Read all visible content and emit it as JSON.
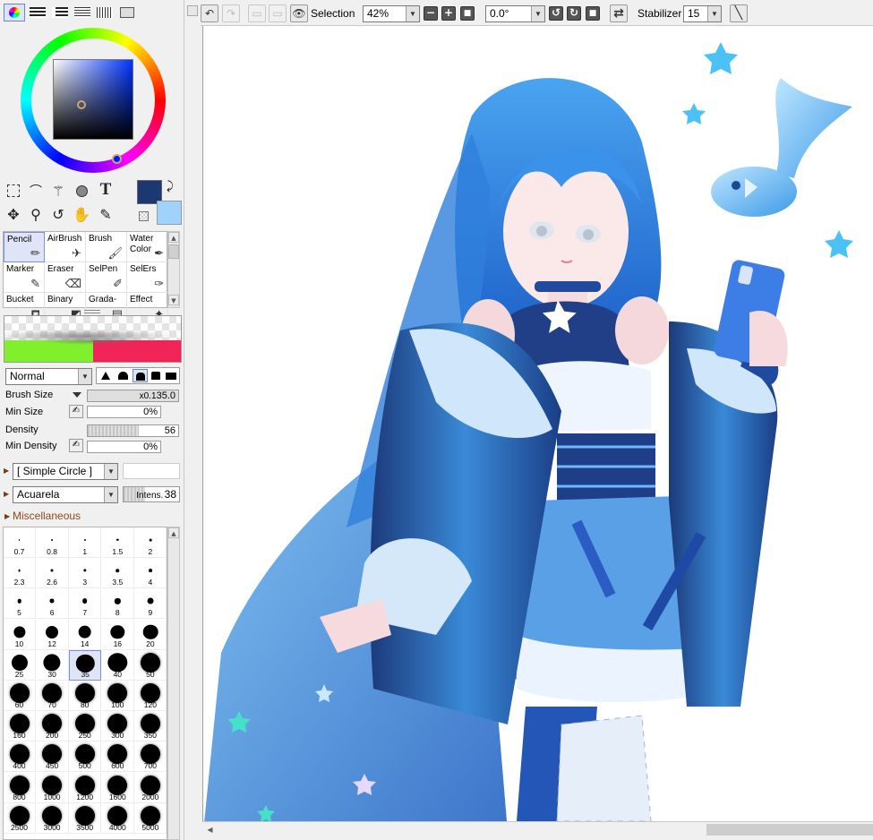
{
  "toolbar": {
    "selection_label": "Selection",
    "zoom_value": "42%",
    "rotation_value": "0.0°",
    "stabilizer_label": "Stabilizer",
    "stabilizer_value": "15"
  },
  "tools": {
    "brush_tools": [
      {
        "label": "Pencil",
        "icon": "pencil-icon",
        "selected": true
      },
      {
        "label": "AirBrush",
        "icon": "airbrush-icon"
      },
      {
        "label": "Brush",
        "icon": "brush-icon"
      },
      {
        "label": "Water Color",
        "icon": "watercolor-icon"
      },
      {
        "label": "Marker",
        "icon": "marker-icon"
      },
      {
        "label": "Eraser",
        "icon": "eraser-icon"
      },
      {
        "label": "SelPen",
        "icon": "selpen-icon"
      },
      {
        "label": "SelErs",
        "icon": "selers-icon"
      },
      {
        "label": "Bucket",
        "icon": "bucket-icon"
      },
      {
        "label": "Binary",
        "icon": "binary-icon"
      },
      {
        "label": "Grada-",
        "icon": "gradation-icon"
      },
      {
        "label": "Effect",
        "icon": "effect-icon"
      }
    ]
  },
  "colors": {
    "primary": "#1c3872",
    "secondary": "#9fd2ff",
    "accent_red": "#f02456",
    "accent_green": "#80f02c"
  },
  "brush": {
    "blend_mode": "Normal",
    "brush_size_label": "Brush Size",
    "brush_size_multiplier": "x0.1",
    "brush_size_value": "35.0",
    "min_size_label": "Min Size",
    "min_size_value": "0%",
    "density_label": "Density",
    "density_value": "56",
    "min_density_label": "Min Density",
    "min_density_value": "0%",
    "shape": "[ Simple Circle ]",
    "texture": "Acuarela",
    "texture_intensity_label": "Intens.",
    "texture_intensity_value": "38",
    "misc_label": "Miscellaneous"
  },
  "sizes": [
    "0.7",
    "0.8",
    "1",
    "1.5",
    "2",
    "2.3",
    "2.6",
    "3",
    "3.5",
    "4",
    "5",
    "6",
    "7",
    "8",
    "9",
    "10",
    "12",
    "14",
    "16",
    "20",
    "25",
    "30",
    "35",
    "40",
    "50",
    "60",
    "70",
    "80",
    "100",
    "120",
    "160",
    "200",
    "250",
    "300",
    "350",
    "400",
    "450",
    "500",
    "600",
    "700",
    "800",
    "1000",
    "1200",
    "1600",
    "2000",
    "2500",
    "3000",
    "3500",
    "4000",
    "5000"
  ],
  "selected_size": "35"
}
